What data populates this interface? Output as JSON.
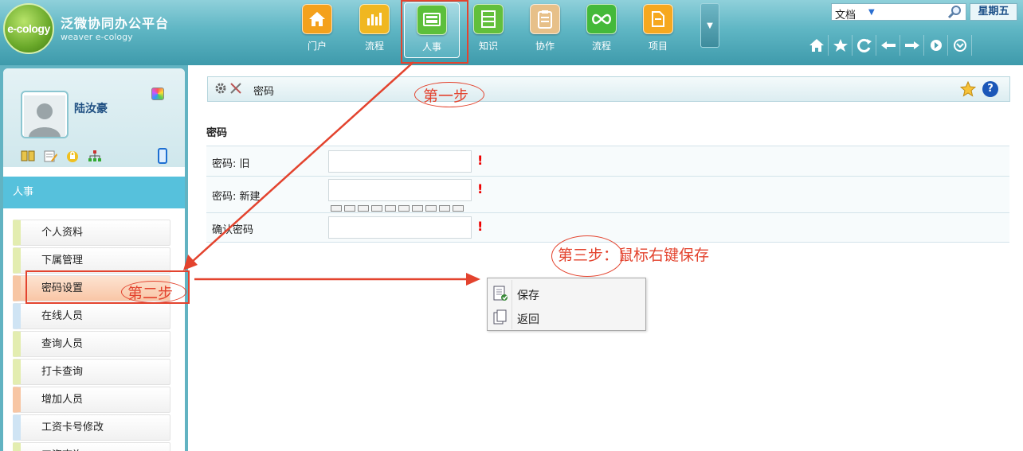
{
  "brand": {
    "logo_text": "e-cology",
    "title": "泛微协同办公平台",
    "subtitle": "weaver e-cology"
  },
  "top_nav": {
    "items": [
      {
        "label": "门户",
        "icon": "home-icon",
        "color": "#f4a11c"
      },
      {
        "label": "流程",
        "icon": "bar-chart-icon",
        "color": "#f0b721"
      },
      {
        "label": "人事",
        "icon": "id-card-icon",
        "color": "#5cbf3a"
      },
      {
        "label": "知识",
        "icon": "cabinet-icon",
        "color": "#62bf3b"
      },
      {
        "label": "协作",
        "icon": "clipboard-icon",
        "color": "#e7c089"
      },
      {
        "label": "流程",
        "icon": "infinity-icon",
        "color": "#44b93a"
      },
      {
        "label": "项目",
        "icon": "folder-icon",
        "color": "#f6a81f"
      }
    ],
    "active_index": 2
  },
  "search": {
    "type_label": "文档",
    "day_label": "星期五"
  },
  "user": {
    "name": "陆汝豪"
  },
  "sidebar": {
    "section_title": "人事",
    "items": [
      {
        "label": "个人资料",
        "stripe": "#e3edb0"
      },
      {
        "label": "下属管理",
        "stripe": "#e3edb0"
      },
      {
        "label": "密码设置",
        "stripe": "#f7c6a4"
      },
      {
        "label": "在线人员",
        "stripe": "#cfe4f4"
      },
      {
        "label": "查询人员",
        "stripe": "#e3edb0"
      },
      {
        "label": "打卡查询",
        "stripe": "#e3edb0"
      },
      {
        "label": "增加人员",
        "stripe": "#f7c6a4"
      },
      {
        "label": "工资卡号修改",
        "stripe": "#cfe4f4"
      },
      {
        "label": "工资查询",
        "stripe": "#e3edb0"
      }
    ],
    "selected_index": 2
  },
  "page": {
    "header_title": "密码",
    "form_title": "密码",
    "fields": [
      {
        "label": "密码: 旧",
        "value": ""
      },
      {
        "label": "密码: 新建",
        "value": ""
      },
      {
        "label": "确认密码",
        "value": ""
      }
    ],
    "required_mark": "!"
  },
  "context_menu": {
    "items": [
      {
        "label": "保存",
        "icon": "save-icon"
      },
      {
        "label": "返回",
        "icon": "back-icon"
      }
    ]
  },
  "annotations": {
    "step1": "第一步",
    "step2": "第二步",
    "step3": "第三步：鼠标右键保存"
  },
  "colors": {
    "annotation": "#e3432e",
    "topbar": "#5fb6c4",
    "section_bar": "#56c1dc"
  }
}
